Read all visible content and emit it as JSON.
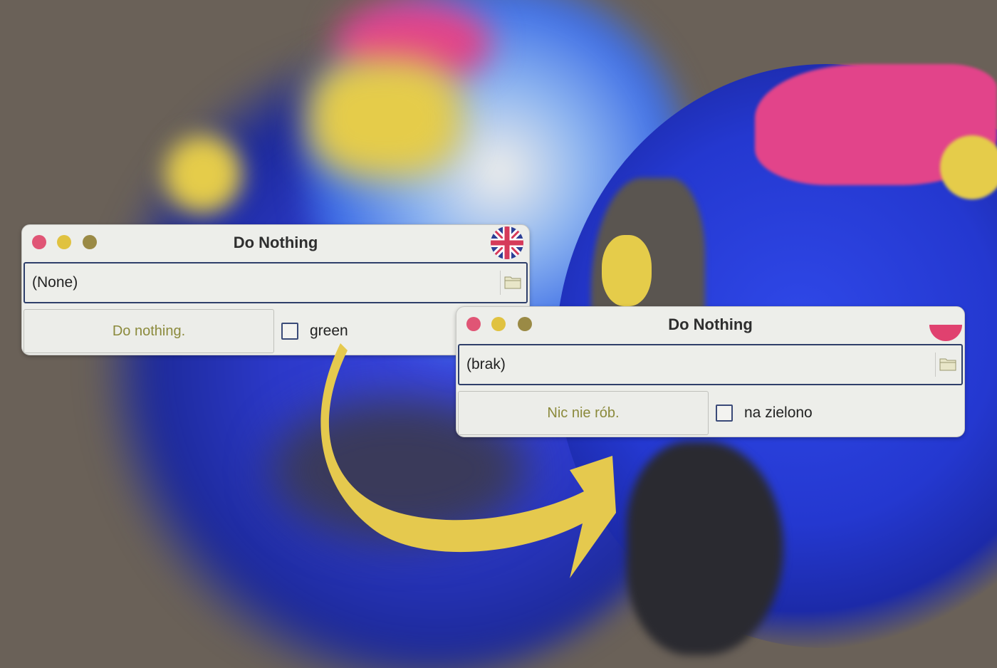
{
  "window_en": {
    "title": "Do Nothing",
    "path_value": "(None)",
    "button_label": "Do nothing.",
    "checkbox_label": "green",
    "checkbox_checked": false,
    "flag_icon": "uk-flag-icon"
  },
  "window_pl": {
    "title": "Do Nothing",
    "path_value": "(brak)",
    "button_label": "Nic nie rób.",
    "checkbox_label": "na zielono",
    "checkbox_checked": false,
    "flag_icon": "poland-flag-icon"
  },
  "colors": {
    "close": "#e05575",
    "minimize": "#e0c240",
    "zoom": "#9a8a45",
    "arrow": "#e5c94e",
    "button_text": "#8b8a3c",
    "field_border": "#2f3f6a"
  }
}
